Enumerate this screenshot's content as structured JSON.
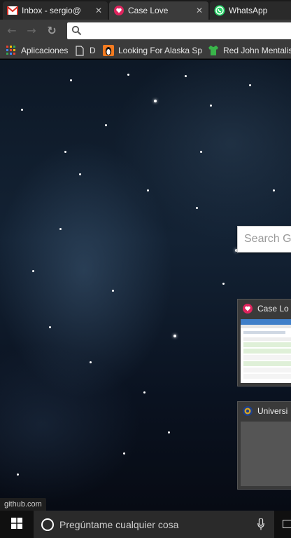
{
  "tabs": [
    {
      "title": "Inbox - sergio@",
      "icon": "gmail-icon",
      "active": false
    },
    {
      "title": "Case Love",
      "icon": "case-love-icon",
      "active": true
    },
    {
      "title": "WhatsApp",
      "icon": "whatsapp-icon",
      "active": false
    }
  ],
  "toolbar": {
    "back": "←",
    "forward": "→",
    "reload": "↻",
    "url": ""
  },
  "bookmarks": [
    {
      "label": "Aplicaciones",
      "icon": "apps-grid-icon"
    },
    {
      "label": "D",
      "icon": "page-icon"
    },
    {
      "label": "Looking For Alaska Sp",
      "icon": "penguin-icon"
    },
    {
      "label": "Red John Mentalis",
      "icon": "shirt-icon"
    }
  ],
  "ntp": {
    "search_placeholder": "Search G",
    "tiles": [
      {
        "title": "Case Lo",
        "icon": "case-love-icon"
      },
      {
        "title": "Universi",
        "icon": "university-seal-icon"
      }
    ]
  },
  "status": {
    "text": "github.com"
  },
  "taskbar": {
    "search_placeholder": "Pregúntame cualquier cosa"
  },
  "colors": {
    "accent_pink": "#e0245e",
    "gmail_red": "#d93025",
    "whatsapp_green": "#25d366",
    "toolbar": "#3b3b3b"
  }
}
